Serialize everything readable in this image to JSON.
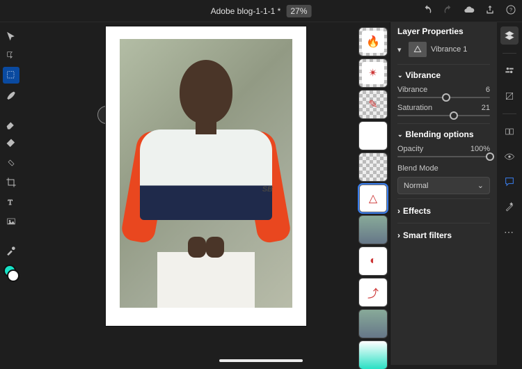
{
  "header": {
    "doc_title": "Adobe blog-1-1-1 *",
    "zoom": "27%"
  },
  "canvas": {
    "logo_text": "SB"
  },
  "thumbs": [
    {
      "id": "layer-hot",
      "type": "chk",
      "style": "background:#fff;",
      "glyph": "🔥"
    },
    {
      "id": "layer-question",
      "type": "chk",
      "style": "background:#fff;",
      "glyph": "✴"
    },
    {
      "id": "layer-outline",
      "type": "chk",
      "style": "",
      "glyph": "✎"
    },
    {
      "id": "layer-blank1",
      "type": "sol",
      "style": "background:#fff;",
      "glyph": ""
    },
    {
      "id": "layer-blank2",
      "type": "chk",
      "style": "",
      "glyph": ""
    },
    {
      "id": "layer-triangle",
      "type": "sol",
      "style": "background:#fff;border:1px solid #666;",
      "glyph": "△",
      "selected": true
    },
    {
      "id": "layer-photo1",
      "type": "img",
      "style": "background:linear-gradient(#8a9,#678);",
      "glyph": ""
    },
    {
      "id": "layer-adjust",
      "type": "sol",
      "style": "background:#fff;",
      "glyph": "◐"
    },
    {
      "id": "layer-curves",
      "type": "sol",
      "style": "background:#fff;",
      "glyph": "⤴"
    },
    {
      "id": "layer-photo2",
      "type": "img",
      "style": "background:linear-gradient(#8a9,#678);",
      "glyph": ""
    },
    {
      "id": "layer-gradient",
      "type": "sol",
      "style": "background:linear-gradient(#fff,#29e0c4);",
      "glyph": ""
    }
  ],
  "panel": {
    "title": "Layer Properties",
    "layer_name": "Vibrance 1",
    "sections": {
      "vibrance": {
        "title": "Vibrance",
        "vibrance": {
          "label": "Vibrance",
          "value": "6",
          "pos": 53
        },
        "saturation": {
          "label": "Saturation",
          "value": "21",
          "pos": 61
        }
      },
      "blend": {
        "title": "Blending options",
        "opacity": {
          "label": "Opacity",
          "value": "100%",
          "pos": 100
        },
        "blendmode_label": "Blend Mode",
        "blendmode_value": "Normal"
      },
      "effects": {
        "title": "Effects"
      },
      "smart": {
        "title": "Smart filters"
      }
    }
  }
}
